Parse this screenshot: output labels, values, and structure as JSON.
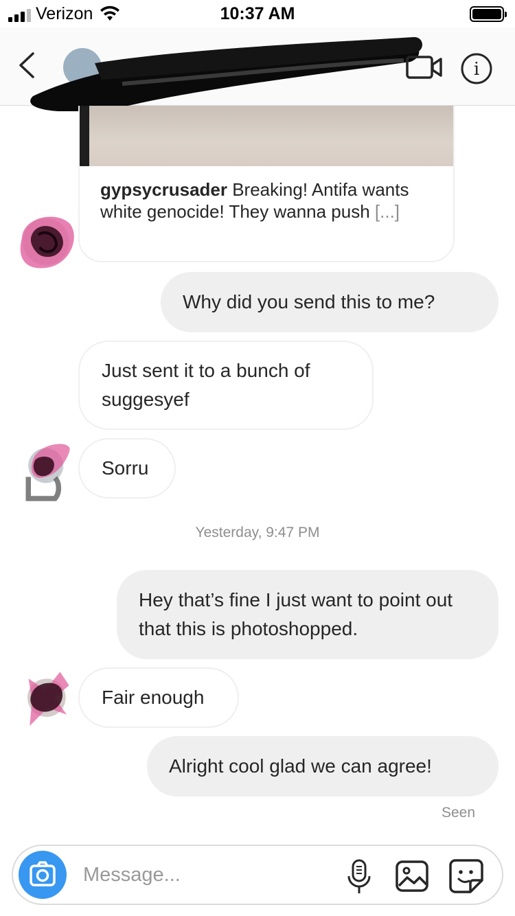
{
  "status_bar": {
    "carrier": "Verizon",
    "time": "10:37 AM",
    "signal_bars_filled": 3,
    "signal_bars_total": 4
  },
  "header": {
    "back_icon": "chevron-left-icon",
    "video_icon": "video-camera-icon",
    "info_icon": "info-icon",
    "info_glyph": "i"
  },
  "messages": {
    "shared_post": {
      "username": "gypsycrusader",
      "caption": " Breaking! Antifa wants white genocide! They wanna push ",
      "more": "[...]"
    },
    "m1": "Why did you send this to me?",
    "m2": "Just sent it to a bunch of suggesyef",
    "m3": "Sorru",
    "timestamp": "Yesterday, 9:47 PM",
    "m4": "Hey that’s fine I just want to point out that this is photoshopped.",
    "m5": "Fair enough",
    "m6": "Alright cool glad we can agree!",
    "seen": "Seen"
  },
  "composer": {
    "placeholder": "Message...",
    "value": "",
    "camera_icon": "camera-icon",
    "mic_icon": "microphone-icon",
    "gallery_icon": "image-icon",
    "sticker_icon": "sticker-icon"
  },
  "colors": {
    "accent_blue": "#3897f0",
    "outgoing_bubble": "#efefef",
    "incoming_border": "#efefef",
    "muted_text": "#8e8e8e",
    "redaction_marker": "#000000",
    "avatar_scribble_pink": "#e0579a"
  }
}
